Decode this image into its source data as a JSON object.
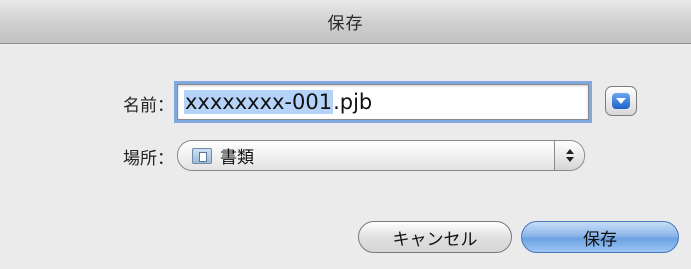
{
  "window": {
    "title": "保存"
  },
  "form": {
    "name_label": "名前：",
    "filename_value": "xxxxxxxx-001.pjb",
    "filename_selected_part": "xxxxxxxx-001",
    "filename_extension": ".pjb",
    "where_label": "場所：",
    "where_value": "書類",
    "where_icon": "folder-icon"
  },
  "buttons": {
    "cancel_label": "キャンセル",
    "save_label": "保存"
  },
  "colors": {
    "accent": "#6ca1e2",
    "selection": "#b5d3f8",
    "focus_ring": "#7fa9e0"
  }
}
